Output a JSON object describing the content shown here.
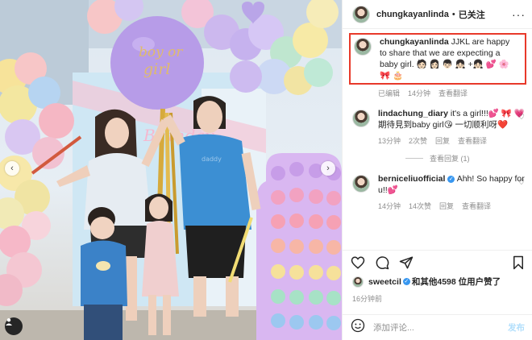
{
  "colors": {
    "accent": "#0095f6",
    "highlight_box": "#e8392a",
    "heart": "#ed4956"
  },
  "post": {
    "author": "chungkayanlinda",
    "separator": "•",
    "follow_status": "已关注",
    "more": "···",
    "balloon_text": "boy or girl",
    "backdrop_text": "Birthday",
    "shirt_text": "daddy"
  },
  "caption": {
    "username": "chungkayanlinda",
    "text": "JJKL are happy to share that we are expecting a baby girl. 🧑🏻 👩🏻 👦🏻 👧🏻 +👧🏻 💕 🌸 🎀 🎂",
    "edited": "已编辑",
    "time": "14分钟",
    "translate": "查看翻译"
  },
  "comments": [
    {
      "username": "lindachung_diary",
      "verified": false,
      "text": "it's a girl!!!💕 🎀 💗 期待見到baby girl😘 一切顺利呀❤️",
      "time": "13分钟",
      "likes": "2次赞",
      "reply": "回复",
      "translate": "查看翻译",
      "view_replies": "查看回复 (1)"
    },
    {
      "username": "berniceliuofficial",
      "verified": true,
      "text": "Ahh! So happy for u!!💕",
      "time": "14分钟",
      "likes": "14次赞",
      "reply": "回复",
      "translate": "查看翻译"
    }
  ],
  "actions": [
    "like-icon",
    "comment-icon",
    "share-icon",
    "save-icon"
  ],
  "likes": {
    "user": "sweetcil",
    "suffix": "和其他4598 位用户赞了"
  },
  "post_time": "16分钟前",
  "add_comment": {
    "placeholder": "添加评论...",
    "post_label": "发布"
  }
}
